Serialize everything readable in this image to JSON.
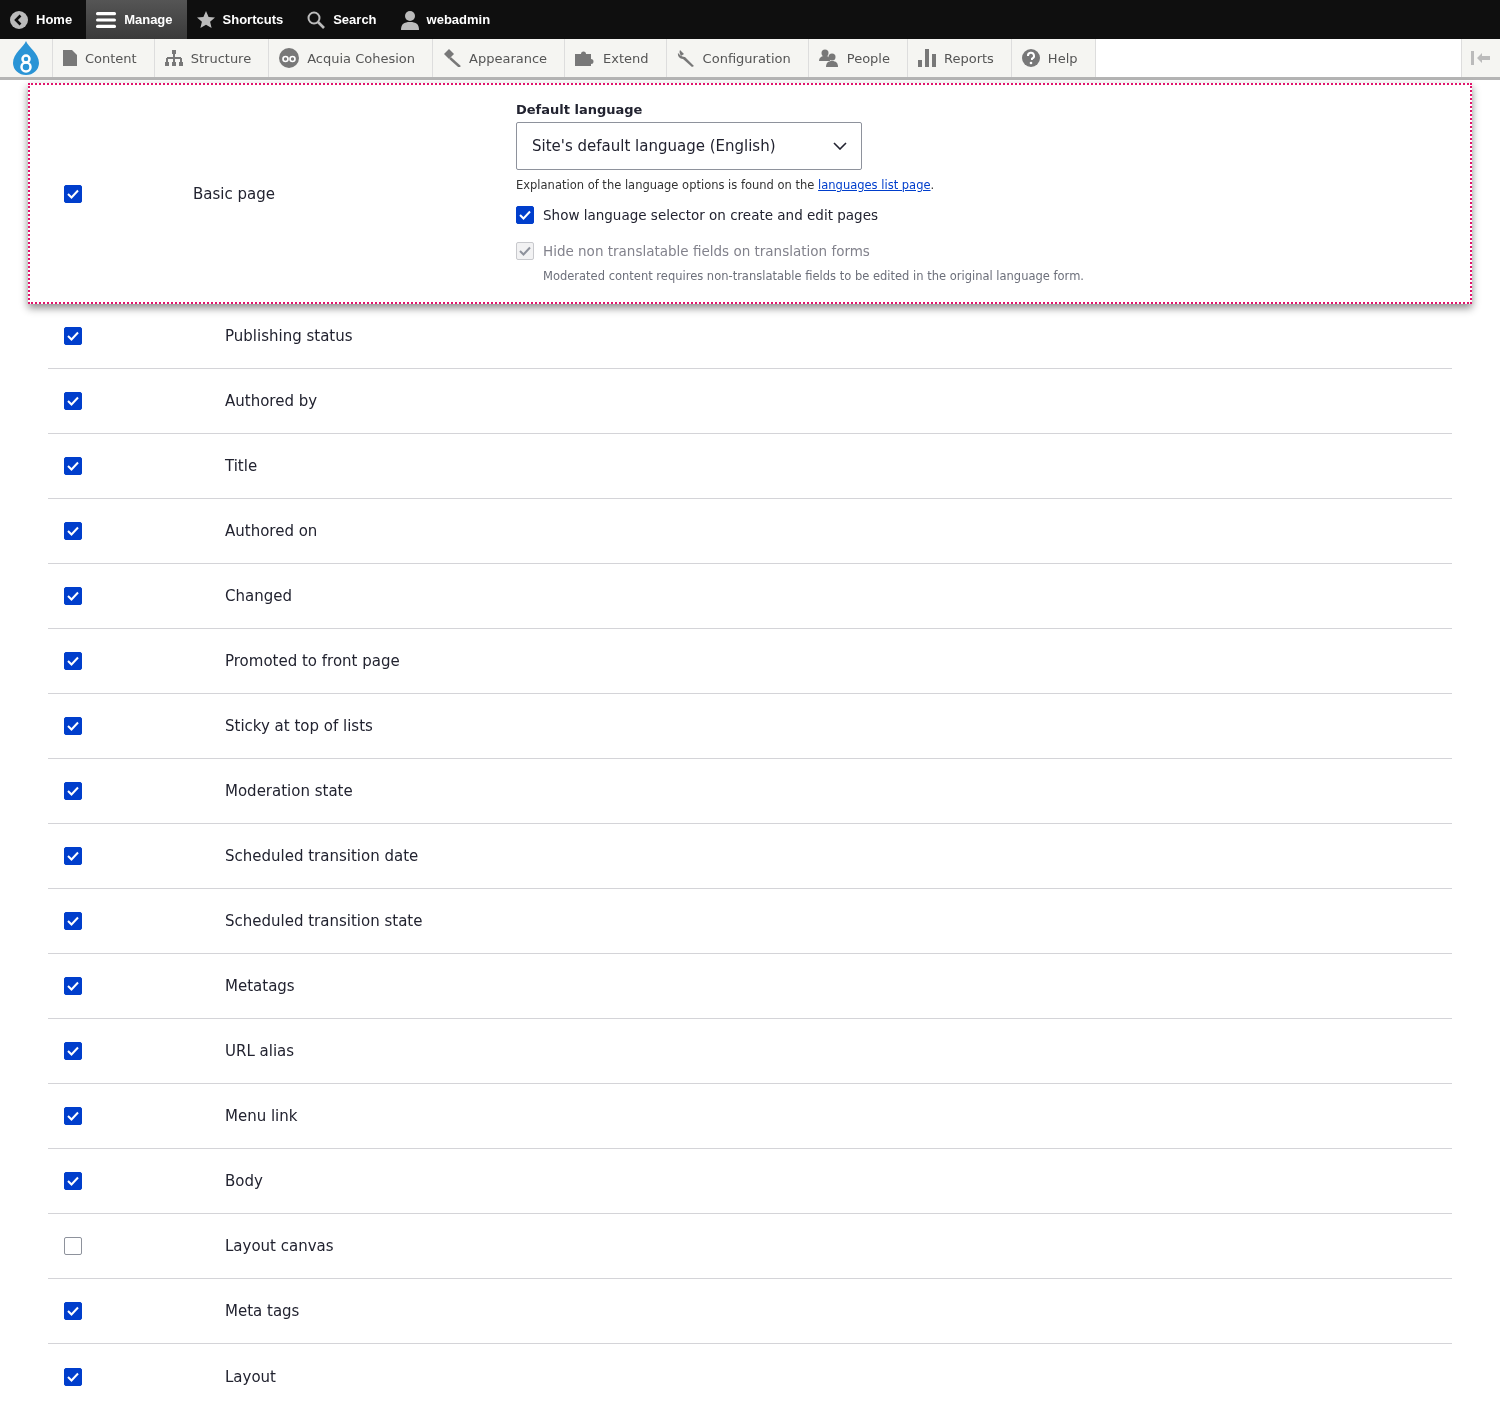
{
  "toolbar": {
    "items": [
      {
        "label": "Home",
        "selected": false
      },
      {
        "label": "Manage",
        "selected": true
      },
      {
        "label": "Shortcuts",
        "selected": false
      },
      {
        "label": "Search",
        "selected": false
      },
      {
        "label": "webadmin",
        "selected": false
      }
    ]
  },
  "admin_menu": {
    "items": [
      {
        "label": "Content"
      },
      {
        "label": "Structure"
      },
      {
        "label": "Acquia Cohesion"
      },
      {
        "label": "Appearance"
      },
      {
        "label": "Extend"
      },
      {
        "label": "Configuration"
      },
      {
        "label": "People"
      },
      {
        "label": "Reports"
      },
      {
        "label": "Help"
      }
    ]
  },
  "content_type": {
    "label": "Basic page",
    "checked": true,
    "default_language": {
      "label": "Default language",
      "value": "Site's default language (English)",
      "description": {
        "text": "Explanation of the language options is found on the",
        "link": "languages list page",
        "end": "."
      }
    },
    "options": [
      {
        "label": "Show language selector on create and edit pages",
        "checked": true,
        "disabled": false
      },
      {
        "label": "Hide non translatable fields on translation forms",
        "checked": true,
        "disabled": true,
        "description": "Moderated content requires non-translatable fields to be edited in the original language form."
      }
    ]
  },
  "fields": [
    {
      "label": "Publishing status",
      "checked": true
    },
    {
      "label": "Authored by",
      "checked": true
    },
    {
      "label": "Title",
      "checked": true
    },
    {
      "label": "Authored on",
      "checked": true
    },
    {
      "label": "Changed",
      "checked": true
    },
    {
      "label": "Promoted to front page",
      "checked": true
    },
    {
      "label": "Sticky at top of lists",
      "checked": true
    },
    {
      "label": "Moderation state",
      "checked": true
    },
    {
      "label": "Scheduled transition date",
      "checked": true
    },
    {
      "label": "Scheduled transition state",
      "checked": true
    },
    {
      "label": "Metatags",
      "checked": true
    },
    {
      "label": "URL alias",
      "checked": true
    },
    {
      "label": "Menu link",
      "checked": true
    },
    {
      "label": "Body",
      "checked": true
    },
    {
      "label": "Layout canvas",
      "checked": false
    },
    {
      "label": "Meta tags",
      "checked": true
    },
    {
      "label": "Layout",
      "checked": true
    }
  ]
}
